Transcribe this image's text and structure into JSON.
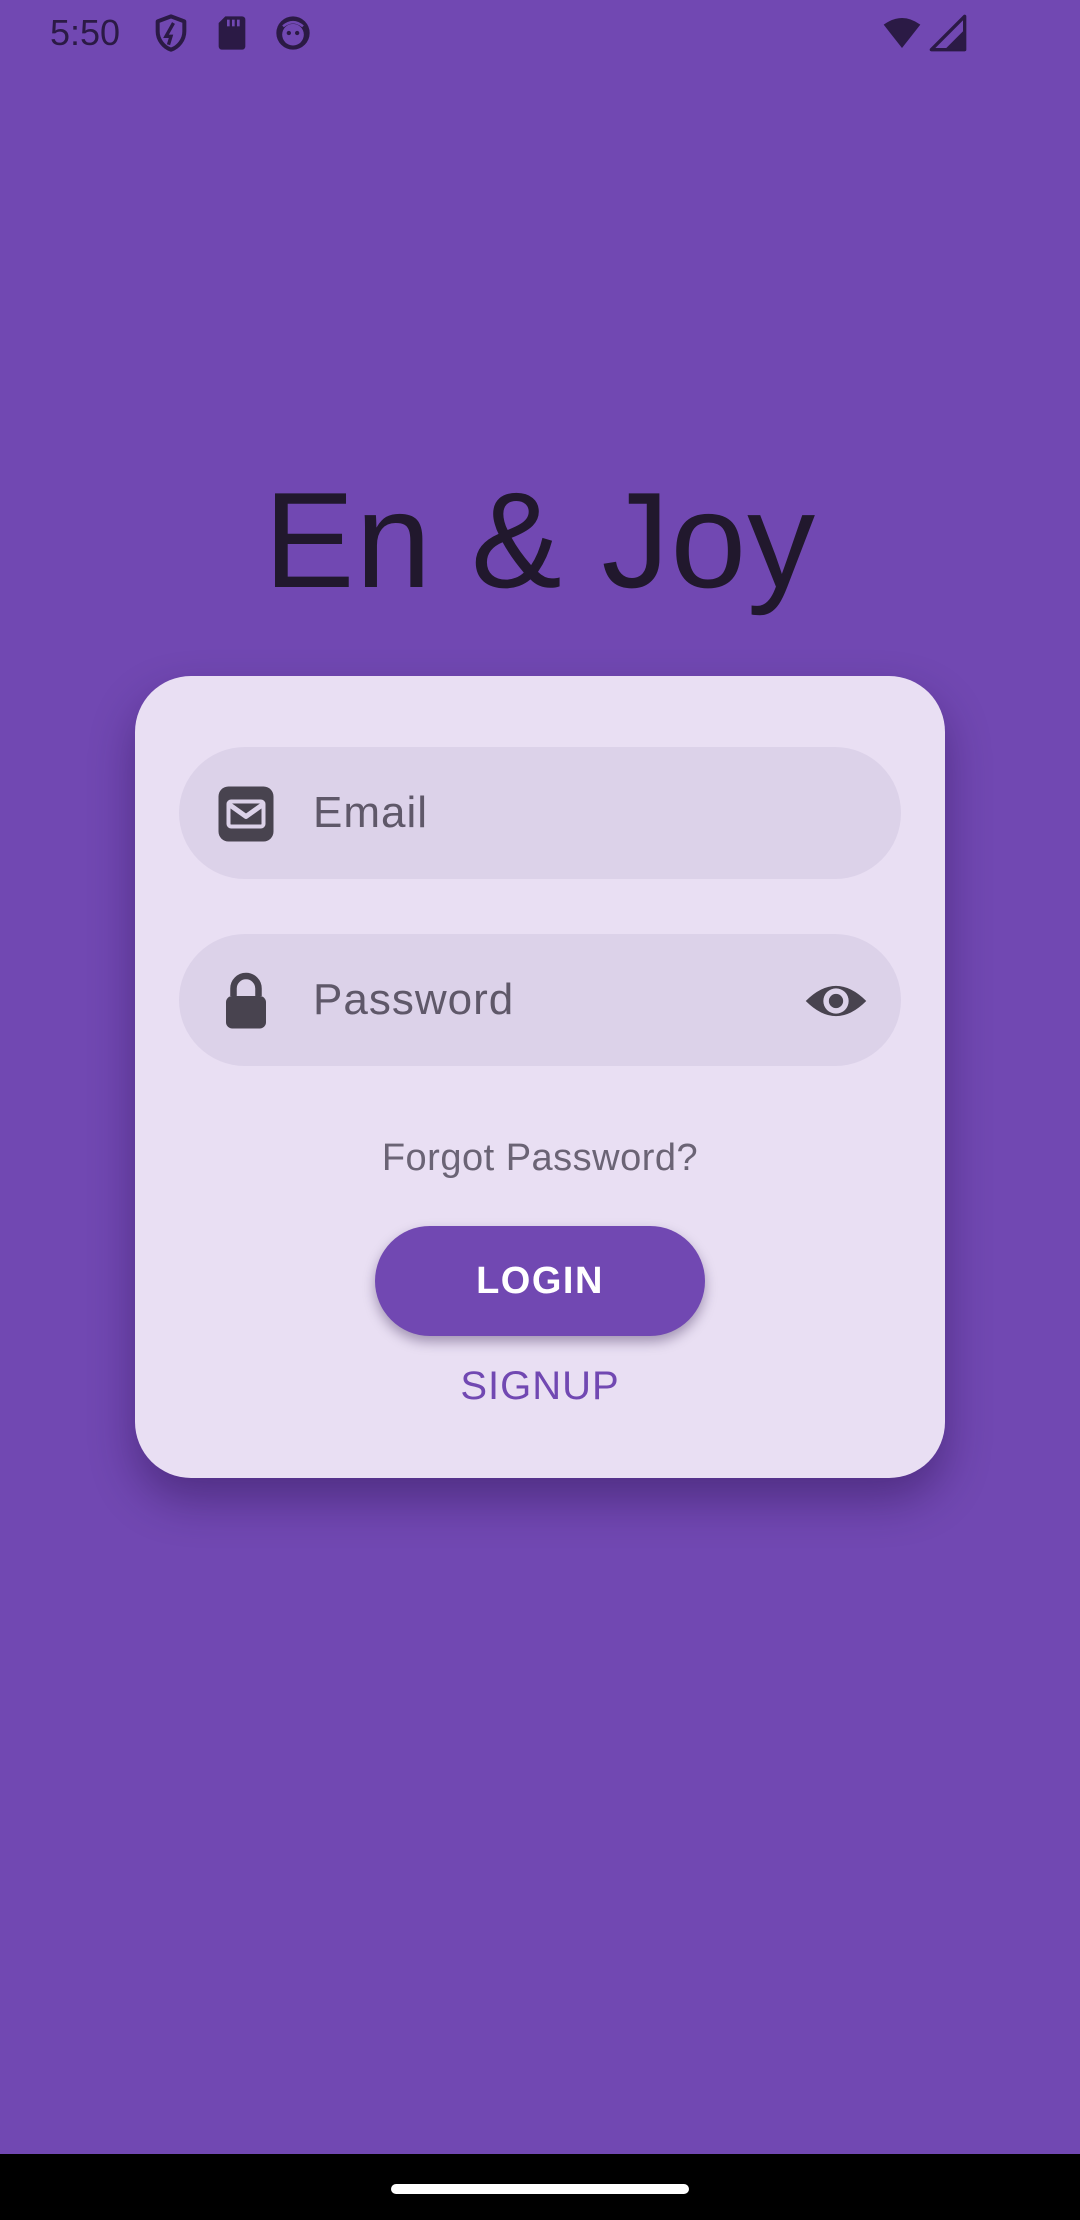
{
  "status_bar": {
    "time": "5:50",
    "left_icons": [
      "shield-icon",
      "sd-card-icon",
      "face-icon"
    ],
    "right_icons": [
      "wifi-icon",
      "cell-signal-icon"
    ]
  },
  "app": {
    "title": "En & Joy"
  },
  "login_form": {
    "email": {
      "placeholder": "Email",
      "value": "",
      "icon": "envelope-icon"
    },
    "password": {
      "placeholder": "Password",
      "value": "",
      "icon": "lock-icon",
      "toggle_icon": "eye-icon"
    },
    "forgot_password_label": "Forgot Password?",
    "login_label": "LOGIN",
    "signup_label": "SIGNUP"
  },
  "colors": {
    "background": "#7148B2",
    "card": "#E9DFF3",
    "field": "#DCD2E9",
    "accent": "#7148B2",
    "title_text": "#21182D"
  }
}
